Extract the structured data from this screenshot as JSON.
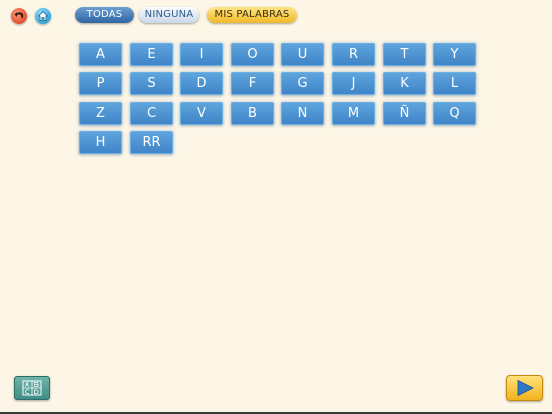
{
  "toolbar": {
    "back_icon": "back-arrow-icon",
    "home_icon": "home-icon",
    "todas_label": "TODAS",
    "ninguna_label": "NINGUNA",
    "mis_palabras_label": "MIS PALABRAS"
  },
  "letters": [
    [
      "A",
      "E",
      "I",
      "O",
      "U",
      "R",
      "T",
      "Y"
    ],
    [
      "P",
      "S",
      "D",
      "F",
      "G",
      "J",
      "K",
      "L"
    ],
    [
      "Z",
      "C",
      "V",
      "B",
      "N",
      "M",
      "Ñ",
      "Q"
    ],
    [
      "H",
      "RR"
    ]
  ],
  "bottom": {
    "alphabet_icon": "alphabet-grid-icon",
    "play_icon": "play-icon"
  },
  "colors": {
    "background": "#fdf6e6",
    "letter_button": "#4a90cf",
    "todas": "#2f66a3",
    "mis_palabras": "#f0b92b",
    "play": "#f2b21c"
  }
}
